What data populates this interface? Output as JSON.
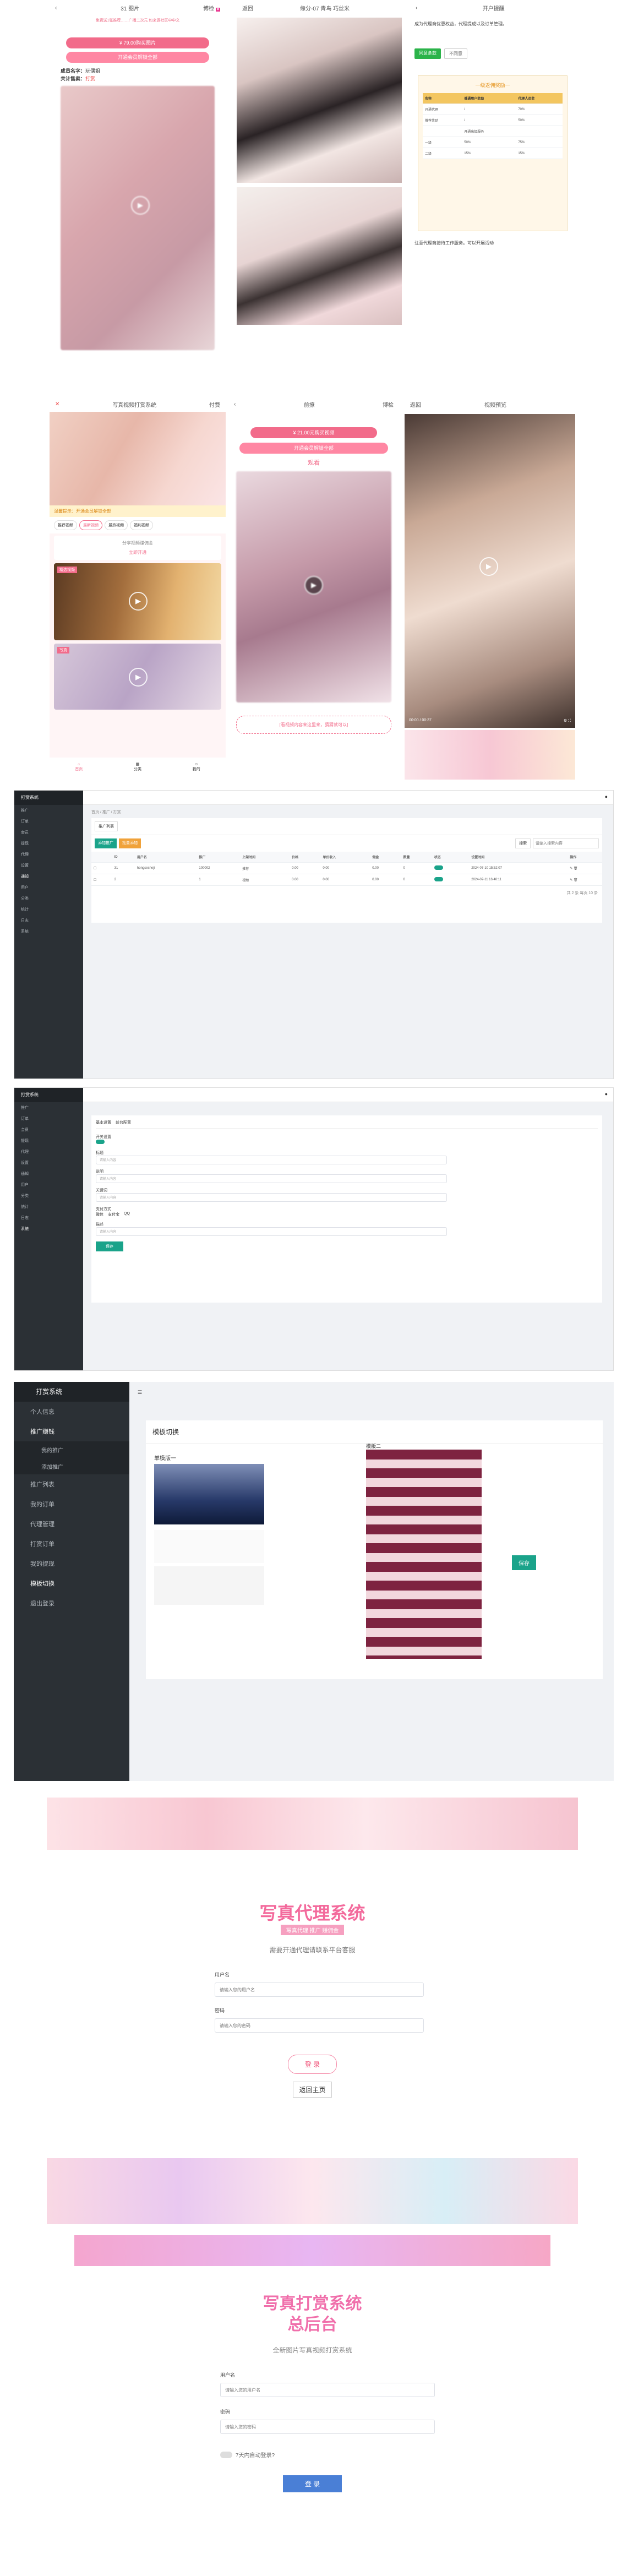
{
  "p1": {
    "back": "‹",
    "title": "31 图片",
    "badge": "博检",
    "note": "免费送1张推荐……广播二次元 如来源社区中中文",
    "buy_btn": "¥ 79.00购买图片",
    "vip_btn": "开通会员解锁全部",
    "name_label": "成员名字：",
    "name_val": "玩偶姐",
    "price_label": "共计售卖：",
    "price_val": "打赏"
  },
  "p2": {
    "title": "缘分-07 青鸟 巧丝米",
    "back": "返回"
  },
  "p3": {
    "title": "开户提醒",
    "text1": "成为代理商优惠权益，代理提成以及订单管理。",
    "confirm": "同意条款",
    "reject": "不同意",
    "table_title": "一级返佣奖励一",
    "table_head": [
      "名称",
      "普通用户奖励",
      "代理人员奖"
    ],
    "rows": [
      [
        "开通代理",
        "/",
        "70%"
      ],
      [
        "推荐奖励",
        "/",
        "50%"
      ],
      [
        "",
        "开通高级服务",
        ""
      ],
      [
        "一级",
        "50%",
        "75%"
      ],
      [
        "二级",
        "15%",
        "15%"
      ]
    ],
    "foot": "注意代理商接待工作服务。可以开展活动"
  },
  "p4": {
    "title": "写真视频打赏系统",
    "badge": "付费",
    "banner_text": "温馨提示：开通会员解锁全部",
    "tabs": [
      "推荐视频",
      "最新视频",
      "最热视频",
      "福利视频"
    ],
    "desc": "分享视频赚佣金",
    "vip": "立即开通",
    "card1": "精选视频",
    "card2": "写真",
    "nav": [
      "首页",
      "分类",
      "我的"
    ]
  },
  "p5": {
    "title": "前撩",
    "badge": "博检",
    "buy_btn": "¥ 21.00元购买视频",
    "vip_btn": "开通会员解锁全部",
    "watch": "观看",
    "ad": "[看视频内容来这里来，猜猜就可以]"
  },
  "p6": {
    "back": "返回",
    "title": "视频预览"
  },
  "admin1": {
    "logo": "打赏系统",
    "breadcrumb": "首页 / 推广 / 打赏",
    "tabs": [
      "推广列表",
      "添加推广",
      "批量添加"
    ],
    "search": "搜索",
    "search_ph": "请输入搜索内容",
    "cols": [
      "",
      "ID",
      "用户名",
      "推广",
      "上架时间",
      "价格",
      "单价收入",
      "佣金",
      "数量",
      "状态",
      "设置时间",
      "操作"
    ],
    "rows": [
      [
        "",
        "31",
        "hongsesheji",
        "100002",
        "推荐",
        "0.00",
        "0.00",
        "0.00",
        "0",
        "",
        "2024-07-10 15:52:07"
      ],
      [
        "",
        "2",
        "",
        "1",
        "视频",
        "0.00",
        "0.00",
        "0.00",
        "0",
        "",
        "2024-07-11 16:40:11"
      ]
    ],
    "pager": "共 2 条 每页 10 条",
    "menu": [
      "推广",
      "订单",
      "会员",
      "提现",
      "代理",
      "设置",
      "通知",
      "用户",
      "分类",
      "统计",
      "日志",
      "系统"
    ]
  },
  "admin2": {
    "logo": "打赏系统",
    "tabs": [
      "基本设置",
      "前台配置"
    ],
    "fields": [
      "开关设置",
      "标题",
      "说明",
      "关键词",
      "描述",
      "支付方式"
    ],
    "ph": "请输入内容",
    "save": "保存",
    "pays": [
      "微信",
      "支付宝",
      "QQ"
    ]
  },
  "admin3": {
    "logo": "打赏系统",
    "menu": [
      "个人信息",
      "推广赚钱",
      "我的推广",
      "添加推广",
      "推广列表",
      "我的订单",
      "代理管理",
      "打赏订单",
      "我的提现",
      "模板切换",
      "退出登录"
    ],
    "page_title": "模板切换",
    "tpl1": "单模版一",
    "tpl2": "模版二",
    "save": "保存"
  },
  "login1": {
    "title": "写真代理系统",
    "sub": "写真代理 推广 赚佣金",
    "desc": "需要开通代理请联系平台客服",
    "user_label": "用户名",
    "user_ph": "请输入您的用户名",
    "pwd_label": "密码",
    "pwd_ph": "请输入您的密码",
    "login": "登 录",
    "home": "返回主页"
  },
  "login2": {
    "title1": "写真打赏系统",
    "title2": "总后台",
    "desc": "全新图片写真视频打赏系统",
    "user_label": "用户名",
    "user_ph": "请输入您的用户名",
    "pwd_label": "密码",
    "pwd_ph": "请输入您的密码",
    "remember": "7天内自动登录?",
    "login": "登 录"
  }
}
